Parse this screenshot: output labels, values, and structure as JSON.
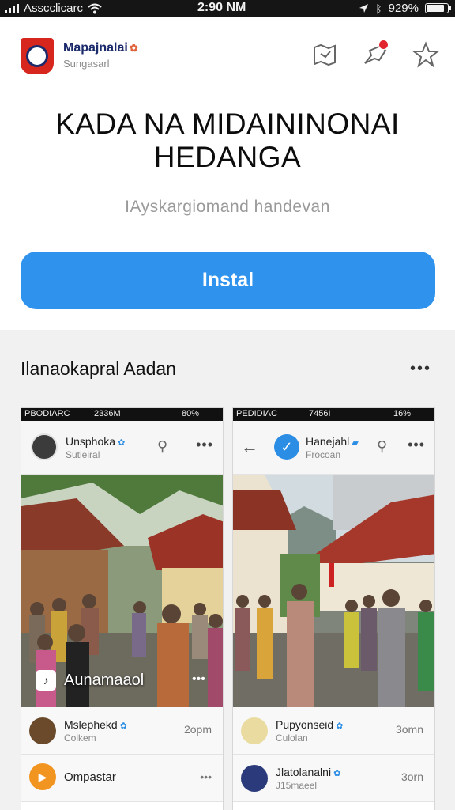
{
  "status_bar": {
    "carrier": "Asscclicarc",
    "time": "2:90 NM",
    "battery": "929%",
    "battery_level": 0.93
  },
  "app": {
    "brand_name": "Mapajnalai",
    "brand_sub": "Sungasarl",
    "title_line1": "KADA NA MIDAININONAI",
    "title_line2": "HEDANGA",
    "subtitle": "IAyskargiomand handevan",
    "install_label": "Instal"
  },
  "icons": {
    "header": [
      "map-icon",
      "share-icon",
      "star-icon"
    ]
  },
  "section": {
    "title": "Ilanaokapral Aadan",
    "more": "•••"
  },
  "screens": [
    {
      "status_left": "PBODIARC",
      "status_time": "2336M",
      "status_right": "80%",
      "name": "Unsphoka",
      "sub": "Sutieiral",
      "more": "•••",
      "overlay_text": "Aunamaaol",
      "rows": [
        {
          "name": "Mslephekd",
          "sub": "Colkem",
          "time": "2opm"
        },
        {
          "name": "Ompastar",
          "sub": "",
          "time": "",
          "more": "•••"
        }
      ]
    },
    {
      "status_left": "PEDIDIAC",
      "status_time": "7456I",
      "status_right": "16%",
      "name": "Hanejahl",
      "sub": "Frocoan",
      "more": "•••",
      "rows": [
        {
          "name": "Pupyonseid",
          "sub": "Culolan",
          "time": "3omn"
        },
        {
          "name": "Jlatolanalni",
          "sub": "J15maeel",
          "time": "3orn"
        }
      ]
    }
  ]
}
